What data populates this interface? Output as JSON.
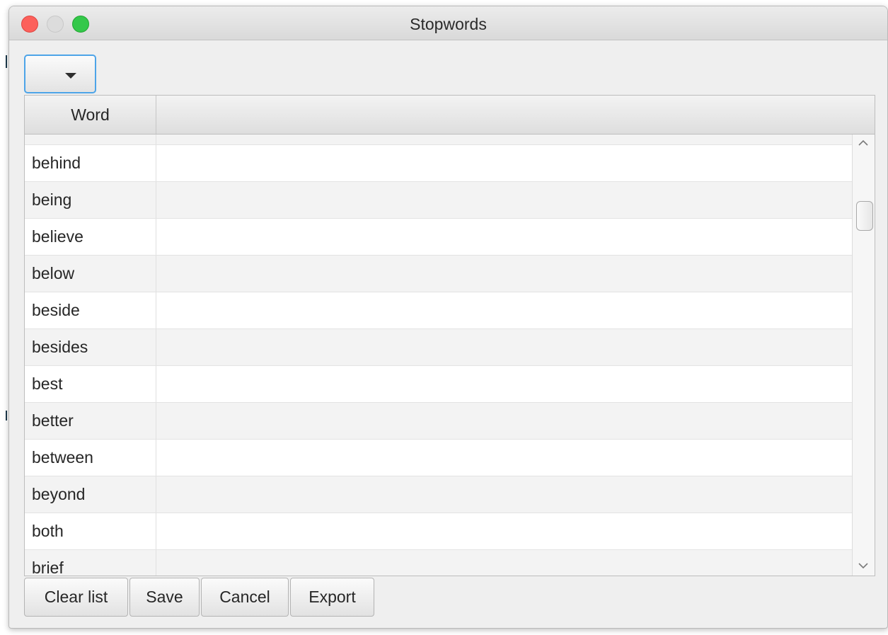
{
  "window": {
    "title": "Stopwords"
  },
  "combo": {
    "value": ""
  },
  "table": {
    "columns": [
      "Word",
      ""
    ],
    "rows": [
      "",
      "behind",
      "being",
      "believe",
      "below",
      "beside",
      "besides",
      "best",
      "better",
      "between",
      "beyond",
      "both",
      "brief"
    ]
  },
  "buttons": {
    "clear": "Clear list",
    "save": "Save",
    "cancel": "Cancel",
    "export": "Export"
  },
  "icons": {
    "combo": "chevron-down-icon",
    "scroll_up": "chevron-up-icon",
    "scroll_down": "chevron-down-icon"
  },
  "colors": {
    "focus": "#4da4e8",
    "close": "#fc605b",
    "maximize": "#34c84a"
  }
}
